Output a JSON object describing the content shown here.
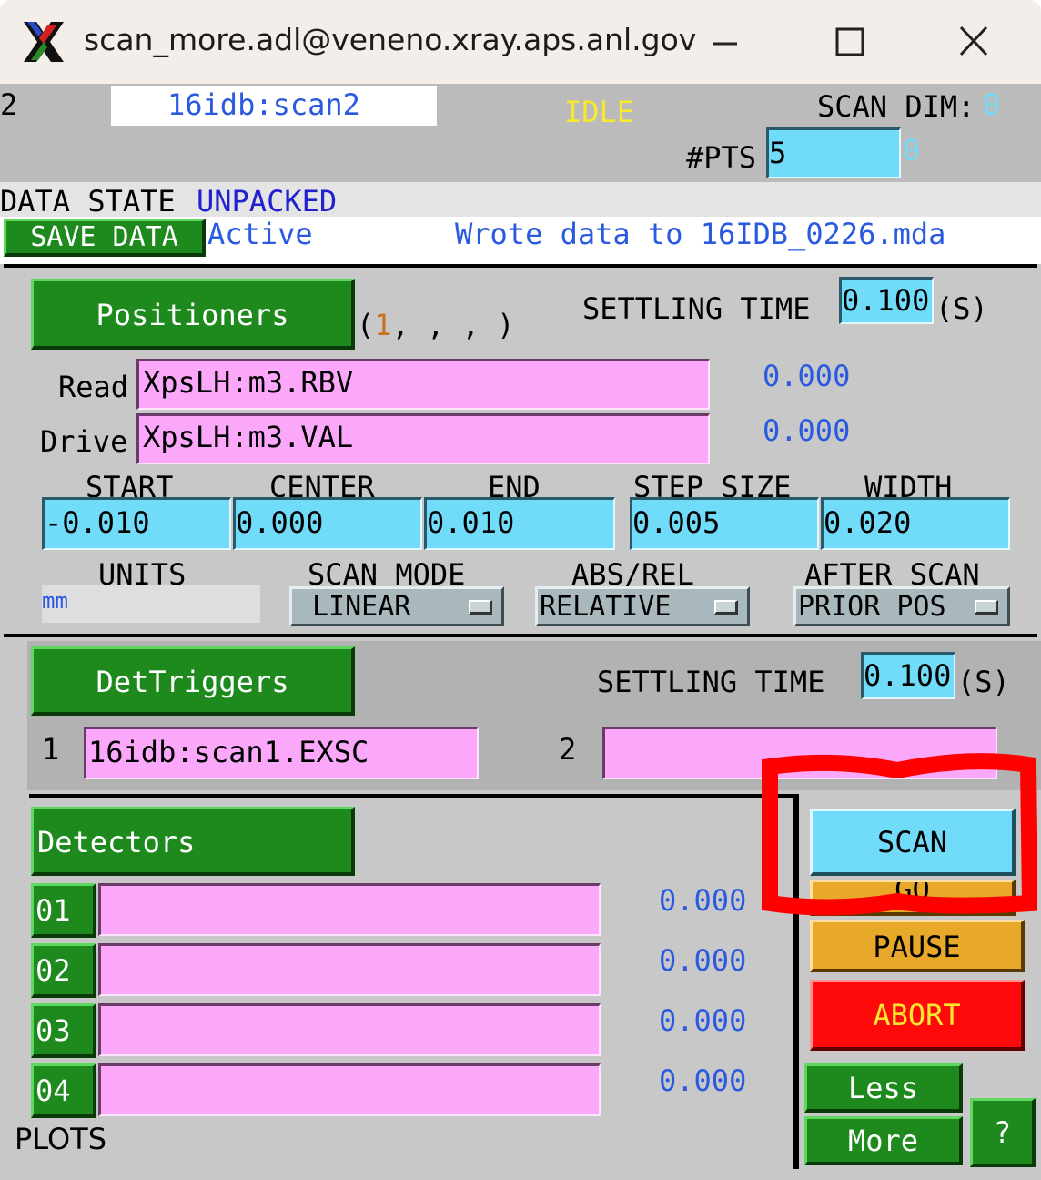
{
  "window": {
    "title": "scan_more.adl@veneno.xray.aps.anl.gov",
    "icon": "x11-icon",
    "controls": [
      "minimize-icon",
      "maximize-icon",
      "close-icon"
    ]
  },
  "header": {
    "scan_index": "2",
    "scan_name": "16idb:scan2",
    "state": "IDLE",
    "scan_dim_label": "SCAN DIM:",
    "scan_dim_value": "0",
    "npts_label": "#PTS",
    "npts_value": "5",
    "npts_current": "0",
    "data_state_label": "DATA STATE",
    "data_state_value": "UNPACKED",
    "save_data_label": "SAVE DATA",
    "save_status": "Active",
    "save_message": "Wrote data to 16IDB_0226.mda"
  },
  "positioners": {
    "button_label": "Positioners",
    "tuple_open": "(",
    "tuple_first": "1",
    "tuple_rest": ", , , )",
    "settling_label": "SETTLING TIME",
    "settling_value": "0.100",
    "settling_unit": "(S)",
    "read_label": "Read",
    "read_pv": "XpsLH:m3.RBV",
    "read_value": "0.000",
    "drive_label": "Drive",
    "drive_pv": "XpsLH:m3.VAL",
    "drive_value": "0.000",
    "start_label": "START",
    "start_value": "-0.010",
    "center_label": "CENTER",
    "center_value": "0.000",
    "end_label": "END",
    "end_value": "0.010",
    "step_label": "STEP SIZE",
    "step_value": "0.005",
    "width_label": "WIDTH",
    "width_value": "0.020",
    "units_label": "UNITS",
    "units_value": "mm",
    "scan_mode_label": "SCAN MODE",
    "scan_mode_value": "LINEAR",
    "abs_rel_label": "ABS/REL",
    "abs_rel_value": "RELATIVE",
    "after_scan_label": "AFTER SCAN",
    "after_scan_value": "PRIOR POS"
  },
  "det_triggers": {
    "button_label": "DetTriggers",
    "settling_label": "SETTLING TIME",
    "settling_value": "0.100",
    "settling_unit": "(S)",
    "trigger1_label": "1",
    "trigger1_value": "16idb:scan1.EXSC",
    "trigger2_label": "2",
    "trigger2_value": ""
  },
  "detectors": {
    "button_label": "Detectors",
    "rows": [
      {
        "num": "01",
        "pv": "",
        "value": "0.000"
      },
      {
        "num": "02",
        "pv": "",
        "value": "0.000"
      },
      {
        "num": "03",
        "pv": "",
        "value": "0.000"
      },
      {
        "num": "04",
        "pv": "",
        "value": "0.000"
      }
    ],
    "plots_label": "PLOTS"
  },
  "controls": {
    "scan_label": "SCAN",
    "go_label": "GO",
    "pause_label": "PAUSE",
    "abort_label": "ABORT",
    "less_label": "Less",
    "more_label": "More",
    "help_label": "?"
  },
  "colors": {
    "panel": "#c8c8c8",
    "cyan_field": "#70dcfa",
    "pink_field": "#fba8fb",
    "green_button": "#1e8a1e",
    "abort_red": "#ff0a0a",
    "pause_orange": "#e8a82a",
    "highlight": "#ff0000"
  }
}
